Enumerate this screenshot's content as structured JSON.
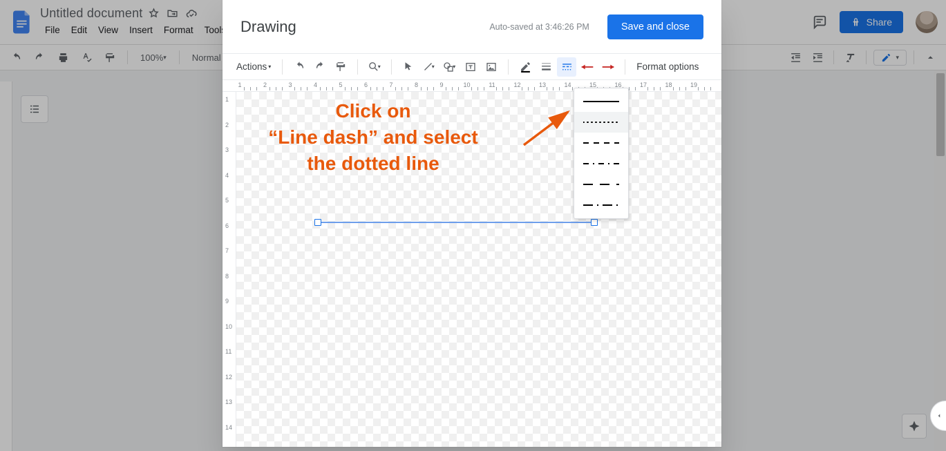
{
  "docs": {
    "title": "Untitled document",
    "menus": [
      "File",
      "Edit",
      "View",
      "Insert",
      "Format",
      "Tools"
    ],
    "zoom": "100%",
    "style_dd": "Normal text",
    "share": "Share"
  },
  "dialog": {
    "title": "Drawing",
    "autosave": "Auto-saved at 3:46:26 PM",
    "save_close": "Save and close",
    "actions": "Actions",
    "format_options": "Format options"
  },
  "annotation": {
    "line1": "Click on",
    "line2": "“Line dash” and select",
    "line3": "the dotted line"
  },
  "dash_options": [
    "solid",
    "dotted",
    "dashed",
    "long-dash",
    "dash-dot",
    "long-dash-dot"
  ],
  "ruler_h_max": 19,
  "ruler_v_max": 14
}
